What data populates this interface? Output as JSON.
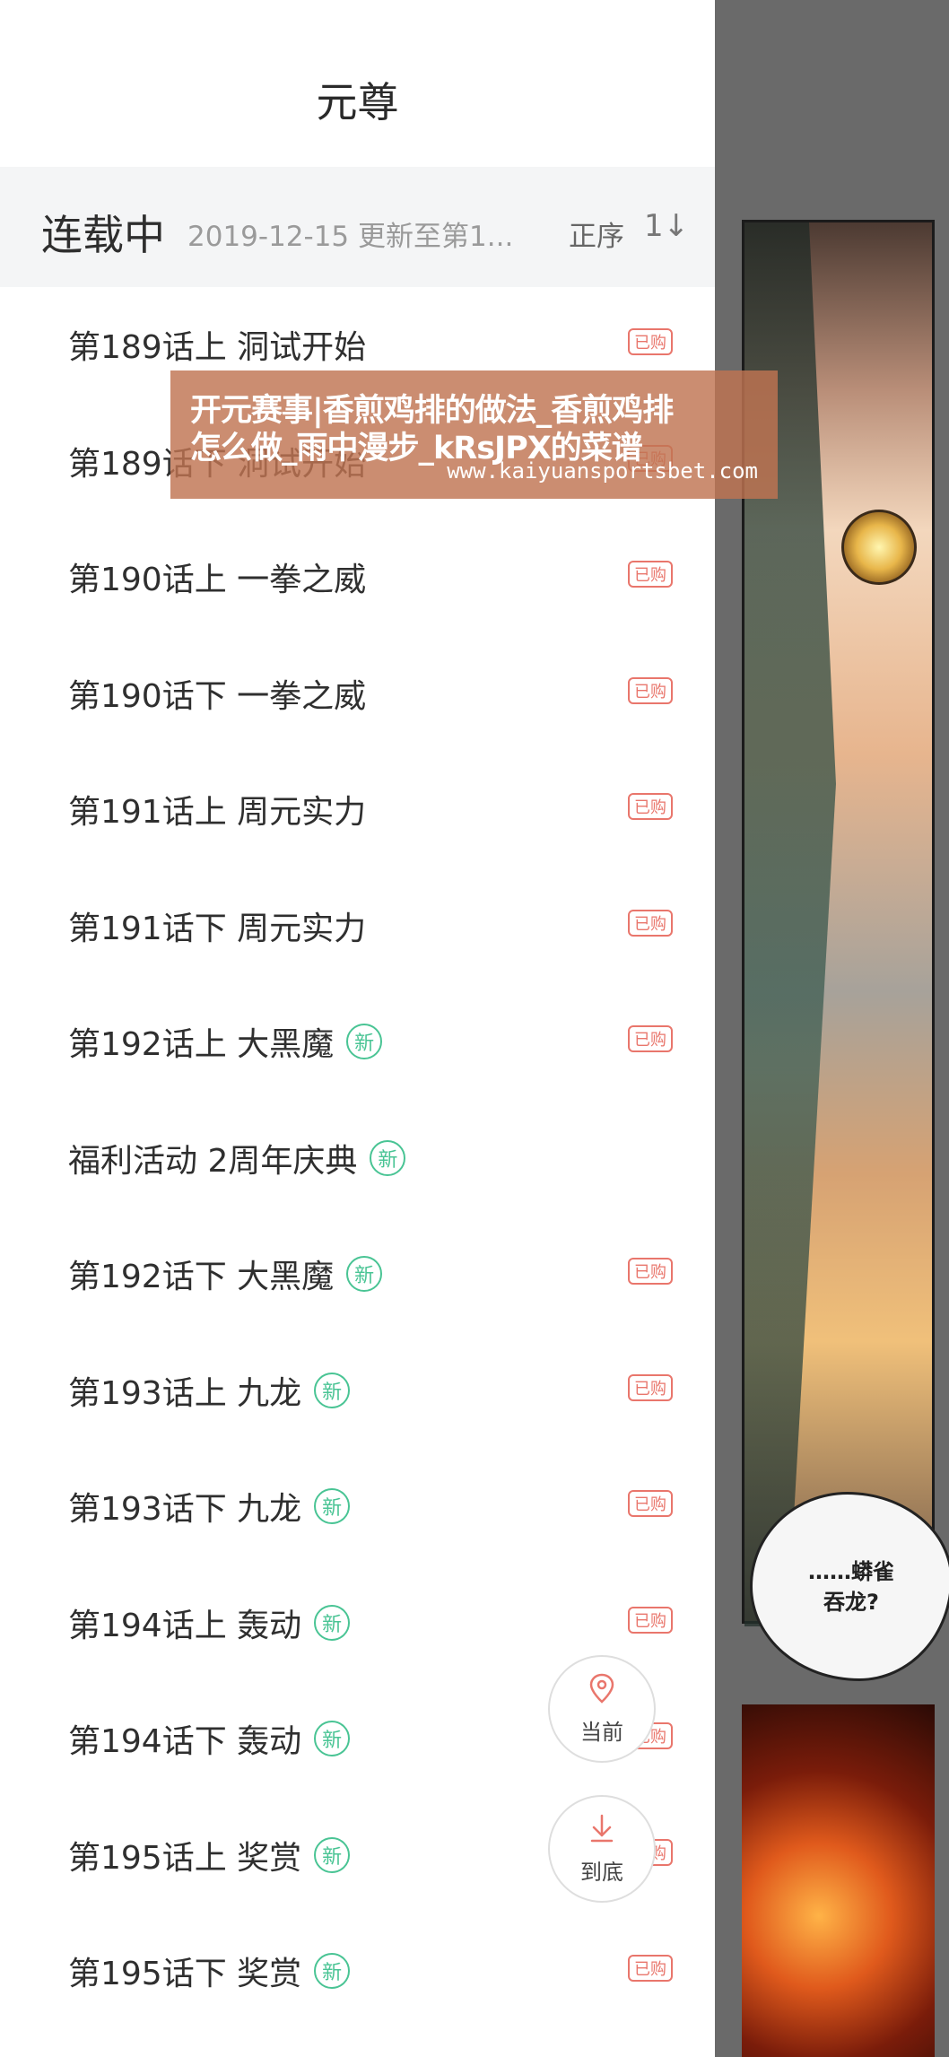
{
  "title": "元尊",
  "status": {
    "label": "连载中",
    "update_text": "2019-12-15 更新至第1...",
    "sort_label": "正序",
    "sort_icon_text": "1↓"
  },
  "chapters": [
    {
      "title": "第189话上 洞试开始",
      "is_new": false,
      "bought_label": "已购"
    },
    {
      "title": "第189话下 洞试开始",
      "is_new": false,
      "bought_label": "已购"
    },
    {
      "title": "第190话上 一拳之威",
      "is_new": false,
      "bought_label": "已购"
    },
    {
      "title": "第190话下 一拳之威",
      "is_new": false,
      "bought_label": "已购"
    },
    {
      "title": "第191话上 周元实力",
      "is_new": false,
      "bought_label": "已购"
    },
    {
      "title": "第191话下 周元实力",
      "is_new": false,
      "bought_label": "已购"
    },
    {
      "title": "第192话上 大黑魔",
      "is_new": true,
      "new_label": "新",
      "bought_label": "已购"
    },
    {
      "title": "福利活动 2周年庆典",
      "is_new": true,
      "new_label": "新",
      "bought_label": ""
    },
    {
      "title": "第192话下 大黑魔",
      "is_new": true,
      "new_label": "新",
      "bought_label": "已购"
    },
    {
      "title": "第193话上 九龙",
      "is_new": true,
      "new_label": "新",
      "bought_label": "已购"
    },
    {
      "title": "第193话下 九龙",
      "is_new": true,
      "new_label": "新",
      "bought_label": "已购"
    },
    {
      "title": "第194话上 轰动",
      "is_new": true,
      "new_label": "新",
      "bought_label": "已购"
    },
    {
      "title": "第194话下 轰动",
      "is_new": true,
      "new_label": "新",
      "bought_label": "已购"
    },
    {
      "title": "第195话上 奖赏",
      "is_new": true,
      "new_label": "新",
      "bought_label": "已购"
    },
    {
      "title": "第195话下 奖赏",
      "is_new": true,
      "new_label": "新",
      "bought_label": "已购"
    }
  ],
  "buttons": {
    "current_label": "当前",
    "current_icon": "location-pin-icon",
    "bottom_label": "到底",
    "bottom_icon": "arrow-down-to-line-icon"
  },
  "watermark": {
    "line1": "开元赛事|香煎鸡排的做法_香煎鸡排",
    "line2": "怎么做_雨中漫步_kRsJPX的菜谱",
    "url": "www.kaiyuansportsbet.com"
  },
  "comic": {
    "bubble_line1": "……蟒雀",
    "bubble_line2": "吞龙?"
  },
  "colors": {
    "new_badge": "#49c494",
    "bought_badge": "#e9766c",
    "watermark_bg": "#bf7452"
  }
}
